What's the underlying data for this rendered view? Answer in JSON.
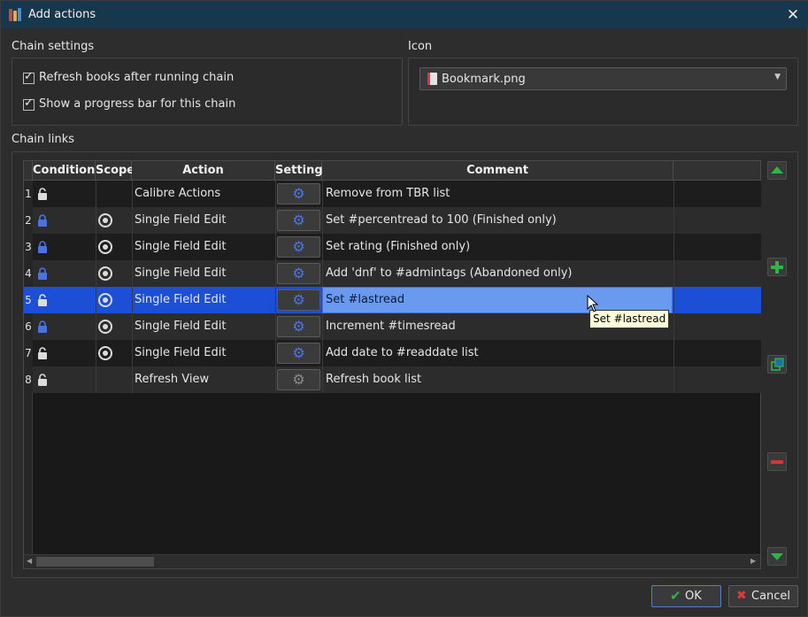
{
  "window": {
    "title": "Add actions"
  },
  "chain_settings": {
    "title": "Chain settings",
    "options": [
      {
        "label": "Refresh books after running chain",
        "checked": true
      },
      {
        "label": "Show a progress bar for this chain",
        "checked": true
      }
    ]
  },
  "icon": {
    "title": "Icon",
    "selected": "Bookmark.png"
  },
  "chain_links": {
    "title": "Chain links",
    "columns": [
      "Conditions",
      "Scope",
      "Action",
      "Settings",
      "Comment"
    ],
    "rows": [
      {
        "num": "1",
        "locked": false,
        "scope": false,
        "action": "Calibre Actions",
        "settings_enabled": true,
        "comment": "Remove from TBR list"
      },
      {
        "num": "2",
        "locked": true,
        "scope": true,
        "action": "Single Field Edit",
        "settings_enabled": true,
        "comment": "Set #percentread to 100 (Finished only)"
      },
      {
        "num": "3",
        "locked": true,
        "scope": true,
        "action": "Single Field Edit",
        "settings_enabled": true,
        "comment": "Set rating (Finished only)"
      },
      {
        "num": "4",
        "locked": true,
        "scope": true,
        "action": "Single Field Edit",
        "settings_enabled": true,
        "comment": "Add 'dnf' to #admintags (Abandoned only)"
      },
      {
        "num": "5",
        "locked": false,
        "scope": true,
        "action": "Single Field Edit",
        "settings_enabled": true,
        "comment": "Set #lastread"
      },
      {
        "num": "6",
        "locked": true,
        "scope": true,
        "action": "Single Field Edit",
        "settings_enabled": true,
        "comment": "Increment #timesread"
      },
      {
        "num": "7",
        "locked": false,
        "scope": true,
        "action": "Single Field Edit",
        "settings_enabled": true,
        "comment": "Add date to #readdate list"
      },
      {
        "num": "8",
        "locked": false,
        "scope": false,
        "action": "Refresh View",
        "settings_enabled": false,
        "comment": "Refresh book list"
      }
    ],
    "tooltip": "Set #lastread"
  },
  "buttons": {
    "ok": "OK",
    "cancel": "Cancel"
  }
}
